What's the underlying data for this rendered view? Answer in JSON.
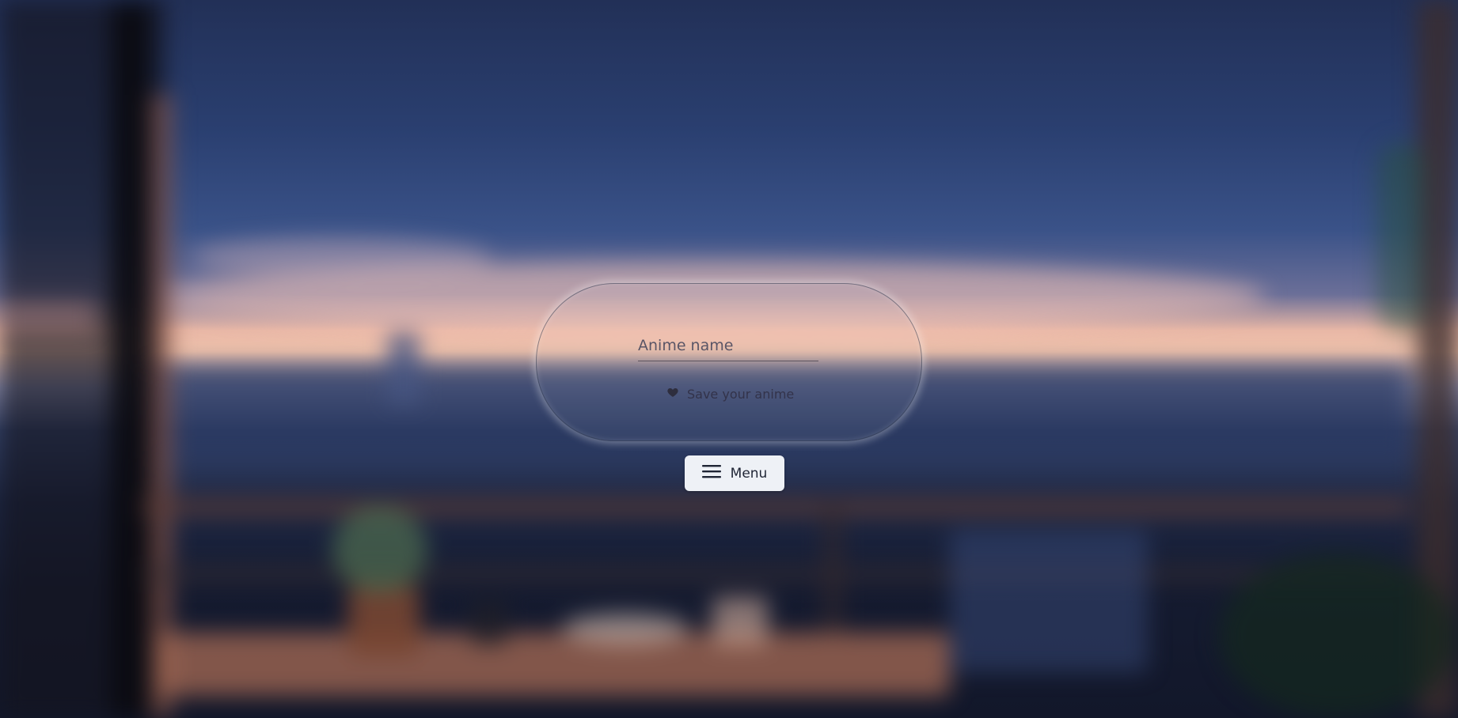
{
  "form": {
    "input_placeholder": "Anime name",
    "input_value": "",
    "save_label": "Save your anime",
    "save_icon": "heart-icon"
  },
  "menu": {
    "label": "Menu",
    "icon": "hamburger-icon"
  },
  "colors": {
    "sky_top": "#223057",
    "horizon_glow": "#f2c4ad",
    "menu_button_bg": "#eef1f6",
    "text_dark": "#1f2535"
  }
}
